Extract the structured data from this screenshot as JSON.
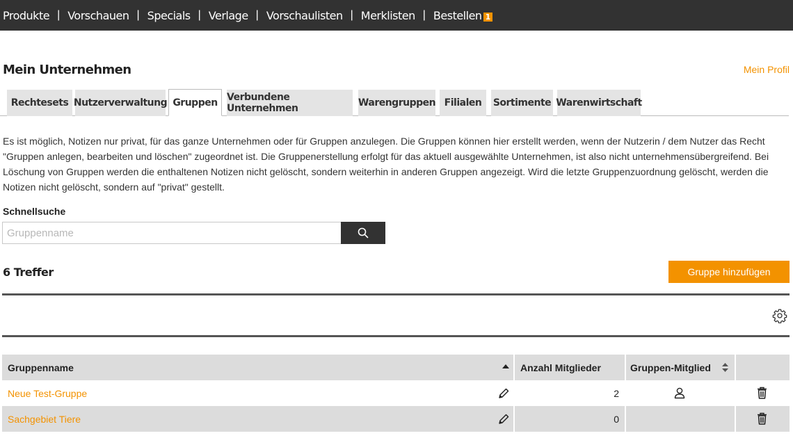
{
  "topnav": {
    "items": [
      {
        "label": "Produkte"
      },
      {
        "label": "Vorschauen"
      },
      {
        "label": "Specials"
      },
      {
        "label": "Verlage"
      },
      {
        "label": "Vorschaulisten"
      },
      {
        "label": "Merklisten"
      },
      {
        "label": "Bestellen",
        "badge": "1"
      }
    ],
    "separator": "|"
  },
  "page": {
    "title": "Mein Unternehmen",
    "profile_link": "Mein Profil"
  },
  "tabs": [
    {
      "label": "Rechtesets"
    },
    {
      "label": "Nutzerverwaltung"
    },
    {
      "label": "Gruppen",
      "active": true
    },
    {
      "label": "Verbundene Unternehmen"
    },
    {
      "label": "Warengruppen"
    },
    {
      "label": "Filialen"
    },
    {
      "label": "Sortimente"
    },
    {
      "label": "Warenwirtschaft"
    }
  ],
  "description": "Es ist möglich, Notizen nur privat, für das ganze Unternehmen oder für Gruppen anzulegen. Die Gruppen können hier erstellt werden, wenn der Nutzerin / dem Nutzer das Recht \"Gruppen anlegen, bearbeiten und löschen\" zugeordnet ist. Die Gruppenerstellung erfolgt für das aktuell ausgewählte Unternehmen, ist also nicht unternehmensübergreifend. Bei Löschung von Gruppen werden die enthaltenen Notizen nicht gelöscht, sondern weiterhin in anderen Gruppen angezeigt. Wird die letzte Gruppenzuordnung gelöscht, werden die Notizen nicht gelöscht, sondern auf \"privat\" gestellt.",
  "search": {
    "label": "Schnellsuche",
    "placeholder": "Gruppenname",
    "value": ""
  },
  "results": {
    "count_label": "6 Treffer",
    "add_button": "Gruppe hinzufügen"
  },
  "table": {
    "columns": {
      "name": "Gruppenname",
      "members": "Anzahl Mitglieder",
      "membership": "Gruppen-Mitglied"
    },
    "rows": [
      {
        "name": "Neue Test-Gruppe",
        "members": "2",
        "is_member": true
      },
      {
        "name": "Sachgebiet Tiere",
        "members": "0",
        "is_member": false
      }
    ]
  },
  "colors": {
    "accent": "#f39200",
    "nav_bg": "#323232",
    "header_bg": "#dcdcdc"
  }
}
